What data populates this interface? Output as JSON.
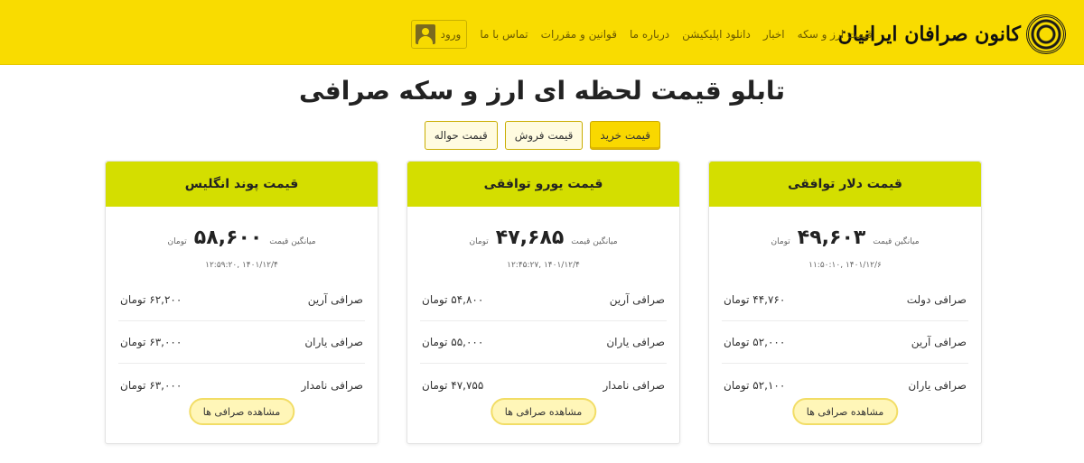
{
  "header": {
    "logo_text": "کانون صرافان ایرانیان",
    "nav": [
      "قیمت ارز و سکه",
      "اخبار",
      "دانلود اپلیکیشن",
      "درباره ما",
      "قوانین و مقررات",
      "تماس با ما"
    ],
    "login_label": "ورود",
    "background_color": "#f9dc00"
  },
  "title": "تابلو قیمت لحظه ای ارز و سکه صرافی",
  "price_types": {
    "buy": "قیمت خرید",
    "sell": "قیمت فروش",
    "transfer": "قیمت حواله",
    "active": "buy"
  },
  "cards": [
    {
      "title": "قیمت دلار توافقی",
      "avg_label": "میانگین قیمت",
      "avg_value": "۴۹,۶۰۳",
      "unit": "تومان",
      "date": "۱۴۰۱/۱۲/۶ ,۱۱:۵۰:۱۰",
      "rows": [
        {
          "name": "صرافی دولت",
          "price": "۴۴,۷۶۰ تومان"
        },
        {
          "name": "صرافی آرین",
          "price": "۵۲,۰۰۰ تومان"
        },
        {
          "name": "صرافی یاران",
          "price": "۵۲,۱۰۰ تومان"
        }
      ],
      "more_label": "مشاهده صرافی ها"
    },
    {
      "title": "قیمت یورو توافقی",
      "avg_label": "میانگین قیمت",
      "avg_value": "۴۷,۶۸۵",
      "unit": "تومان",
      "date": "۱۴۰۱/۱۲/۴ ,۱۲:۴۵:۲۷",
      "rows": [
        {
          "name": "صرافی آرین",
          "price": "۵۴,۸۰۰ تومان"
        },
        {
          "name": "صرافی یاران",
          "price": "۵۵,۰۰۰ تومان"
        },
        {
          "name": "صرافی نامدار",
          "price": "۴۷,۷۵۵ تومان"
        }
      ],
      "more_label": "مشاهده صرافی ها"
    },
    {
      "title": "قیمت پوند انگلیس",
      "avg_label": "میانگین قیمت",
      "avg_value": "۵۸,۶۰۰",
      "unit": "تومان",
      "date": "۱۴۰۱/۱۲/۴ ,۱۲:۵۹:۲۰",
      "rows": [
        {
          "name": "صرافی آرین",
          "price": "۶۲,۲۰۰ تومان"
        },
        {
          "name": "صرافی یاران",
          "price": "۶۳,۰۰۰ تومان"
        },
        {
          "name": "صرافی نامدار",
          "price": "۶۳,۰۰۰ تومان"
        }
      ],
      "more_label": "مشاهده صرافی ها"
    }
  ],
  "colors": {
    "card_header": "#d4de00",
    "accent": "#f9d800"
  }
}
